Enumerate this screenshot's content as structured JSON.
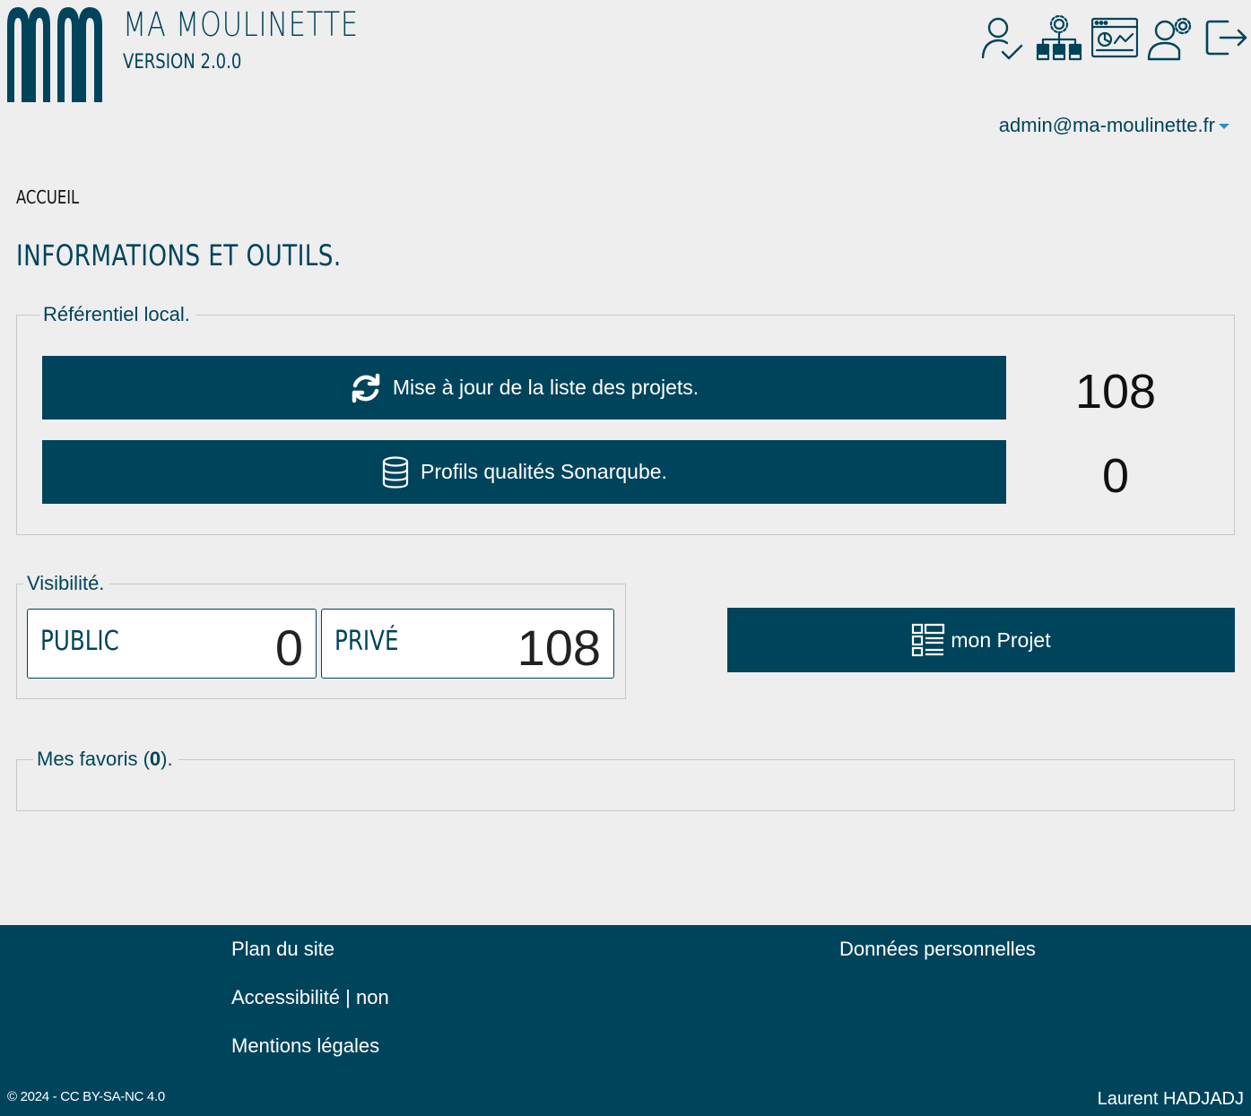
{
  "app": {
    "title": "MA MOULINETTE",
    "version": "VERSION 2.0.0",
    "logo_icon": "mm-logo-icon"
  },
  "toolbar": [
    {
      "icon": "user-check-icon"
    },
    {
      "icon": "org-settings-icon"
    },
    {
      "icon": "dashboard-chart-icon"
    },
    {
      "icon": "user-settings-icon"
    },
    {
      "icon": "logout-icon"
    }
  ],
  "user": {
    "email": "admin@ma-moulinette.fr"
  },
  "breadcrumb": "ACCUEIL",
  "page_title": "INFORMATIONS ET OUTILS.",
  "referentiel": {
    "legend": "Référentiel local.",
    "update_button": "Mise à jour de la liste des projets.",
    "update_icon": "refresh-icon",
    "projects_count": "108",
    "profiles_button": "Profils qualités Sonarqube.",
    "profiles_icon": "database-icon",
    "profiles_count": "0"
  },
  "visibilite": {
    "legend": "Visibilité.",
    "public_label": "PUBLIC",
    "public_value": "0",
    "prive_label": "PRIVÉ",
    "prive_value": "108"
  },
  "mon_projet": {
    "label": "mon Projet",
    "icon": "project-list-icon"
  },
  "favoris": {
    "prefix": "Mes favoris (",
    "count": "0",
    "suffix": ")."
  },
  "footer": {
    "plan": "Plan du site",
    "accessibilite": "Accessibilité | non",
    "mentions": "Mentions légales",
    "donnees": "Données personnelles",
    "copyright": "© 2024 - CC BY-SA-NC 4.0",
    "author": "Laurent HADJADJ"
  },
  "colors": {
    "brand": "#00445c",
    "background": "#eeeeee",
    "caret": "#2a8fd0"
  }
}
